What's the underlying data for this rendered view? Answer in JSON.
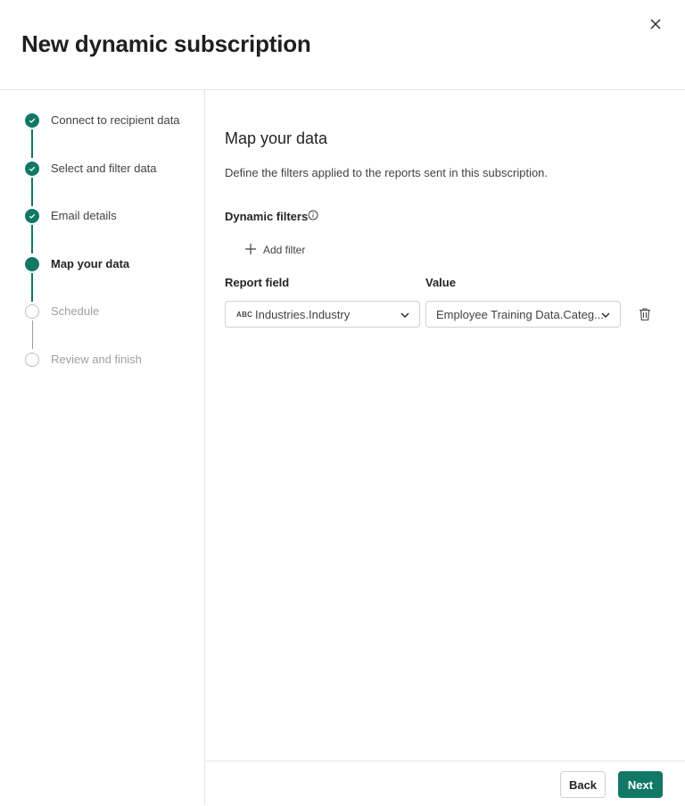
{
  "dialog": {
    "title": "New dynamic subscription",
    "close_icon": "close-icon"
  },
  "steps": [
    {
      "label": "Connect to recipient data",
      "state": "done"
    },
    {
      "label": "Select and filter data",
      "state": "done"
    },
    {
      "label": "Email details",
      "state": "done"
    },
    {
      "label": "Map your data",
      "state": "current"
    },
    {
      "label": "Schedule",
      "state": "todo"
    },
    {
      "label": "Review and finish",
      "state": "todo"
    }
  ],
  "main": {
    "heading": "Map your data",
    "description": "Define the filters applied to the reports sent in this subscription.",
    "dynamic_filters_label": "Dynamic filters",
    "add_filter_label": "Add filter",
    "columns": {
      "report_field": "Report field",
      "value": "Value"
    },
    "filters": [
      {
        "field_type_badge": "ABC",
        "report_field": "Industries.Industry",
        "value": "Employee Training Data.Categ..."
      }
    ]
  },
  "footer": {
    "back_label": "Back",
    "next_label": "Next"
  },
  "colors": {
    "accent": "#117865"
  }
}
